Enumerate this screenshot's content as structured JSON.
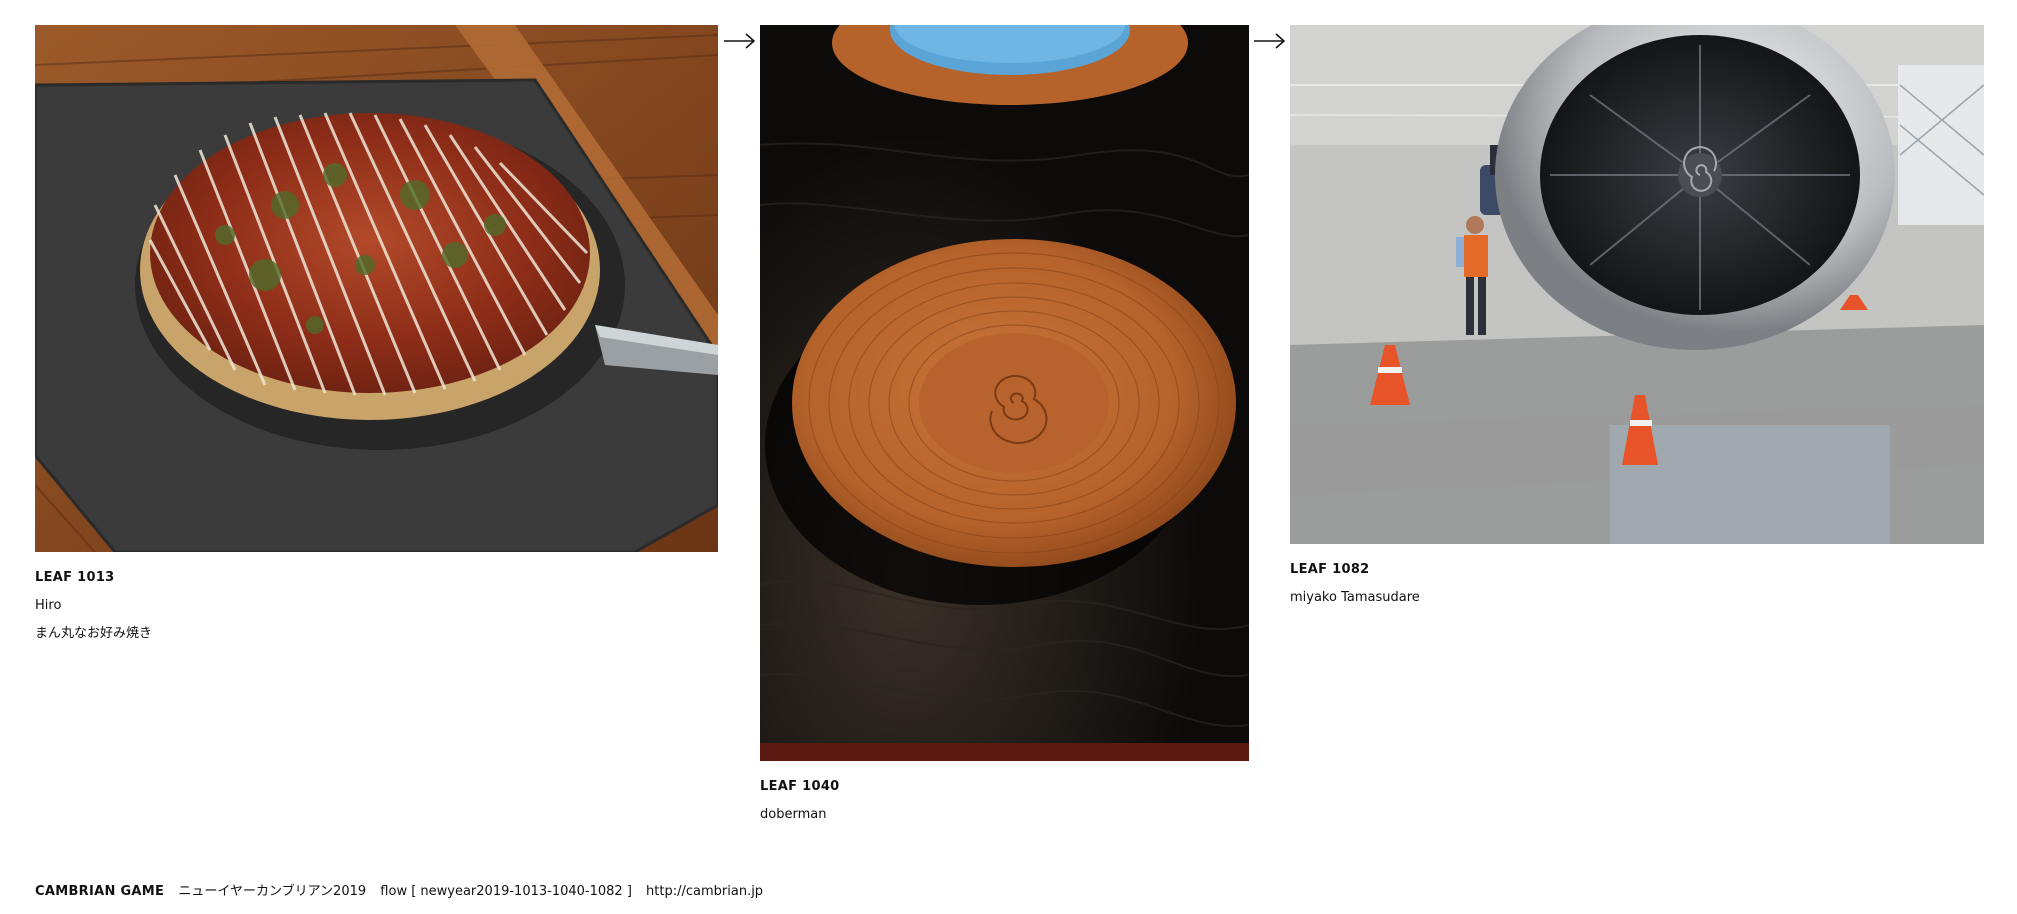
{
  "leaves": [
    {
      "number": "LEAF 1013",
      "author": "Hiro",
      "note": "まん丸なお好み焼き"
    },
    {
      "number": "LEAF 1040",
      "author": "doberman"
    },
    {
      "number": "LEAF 1082",
      "author": "miyako Tamasudare"
    }
  ],
  "footer": {
    "brand": "CAMBRIAN GAME",
    "title": "ニューイヤーカンブリアン2019",
    "flow": "flow [ newyear2019-1013-1040-1082 ]",
    "url": "http://cambrian.jp"
  }
}
